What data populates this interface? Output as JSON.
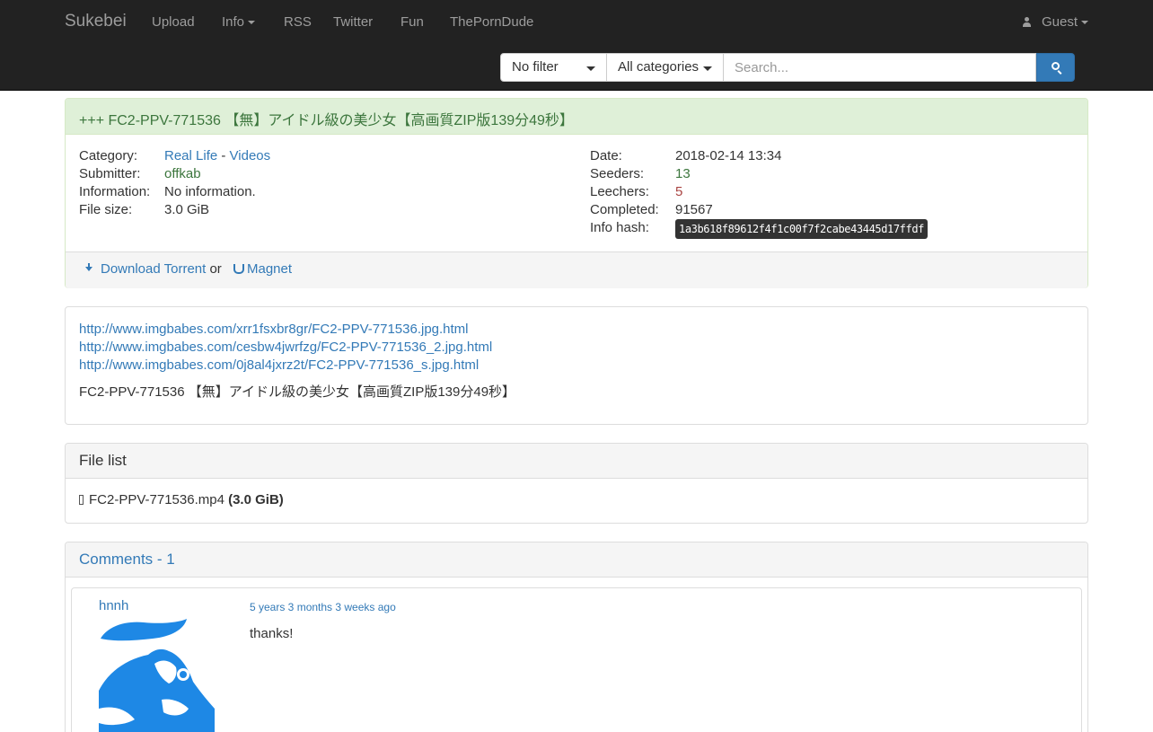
{
  "nav": {
    "brand": "Sukebei",
    "items": [
      "Upload",
      "Info",
      "RSS",
      "Twitter",
      "Fun",
      "ThePornDude"
    ],
    "user": "Guest"
  },
  "search": {
    "filter": "No filter",
    "category": "All categories",
    "placeholder": "Search..."
  },
  "torrent": {
    "title": "+++ FC2-PPV-771536 【無】アイドル級の美少女【高画質ZIP版139分49秒】",
    "labels": {
      "category": "Category:",
      "submitter": "Submitter:",
      "information": "Information:",
      "file_size": "File size:",
      "date": "Date:",
      "seeders": "Seeders:",
      "leechers": "Leechers:",
      "completed": "Completed:",
      "info_hash": "Info hash:"
    },
    "category_main": "Real Life",
    "category_sep": "-",
    "category_sub": "Videos",
    "submitter": "offkab",
    "information": "No information.",
    "file_size": "3.0 GiB",
    "date": "2018-02-14 13:34",
    "seeders": "13",
    "leechers": "5",
    "completed": "91567",
    "info_hash": "1a3b618f89612f4f1c00f7f2cabe43445d17ffdf",
    "download_label": "Download Torrent",
    "or": "or",
    "magnet_label": "Magnet"
  },
  "description": {
    "links": [
      "http://www.imgbabes.com/xrr1fsxbr8gr/FC2-PPV-771536.jpg.html",
      "http://www.imgbabes.com/cesbw4jwrfzg/FC2-PPV-771536_2.jpg.html",
      "http://www.imgbabes.com/0j8al4jxrz2t/FC2-PPV-771536_s.jpg.html"
    ],
    "text": "FC2-PPV-771536 【無】アイドル級の美少女【高画質ZIP版139分49秒】"
  },
  "file_list": {
    "title": "File list",
    "file_name": "FC2-PPV-771536.mp4",
    "file_size": "(3.0 GiB)"
  },
  "comments": {
    "title": "Comments - 1",
    "items": [
      {
        "user": "hnnh",
        "date": "5 years 3 months 3 weeks ago",
        "text": "thanks!"
      }
    ]
  },
  "colors": {
    "navbar": "#222222",
    "success_heading": "#dff0d8",
    "link": "#337ab7",
    "seeders": "#3c763d",
    "leechers": "#a94442",
    "avatar": "#1e88e5"
  }
}
